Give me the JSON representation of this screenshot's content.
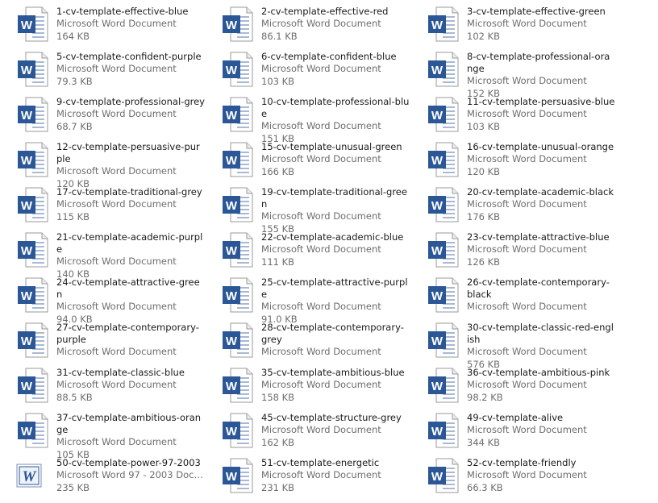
{
  "colors": {
    "word_blue": "#2b5797",
    "name_text": "#1a1a1a",
    "meta_text": "#6d6d6d"
  },
  "icons": {
    "doc": "word-document-icon",
    "doc97": "word-97-2003-document-icon"
  },
  "files": [
    {
      "name": "1-cv-template-effective-blue",
      "type": "Microsoft Word Document",
      "size": "164 KB"
    },
    {
      "name": "2-cv-template-effective-red",
      "type": "Microsoft Word Document",
      "size": "86.1 KB"
    },
    {
      "name": "3-cv-template-effective-green",
      "type": "Microsoft Word Document",
      "size": "102 KB"
    },
    {
      "name": "5-cv-template-confident-purple",
      "type": "Microsoft Word Document",
      "size": "79.3 KB"
    },
    {
      "name": "6-cv-template-confident-blue",
      "type": "Microsoft Word Document",
      "size": "103 KB"
    },
    {
      "name": "8-cv-template-professional-orange",
      "type": "Microsoft Word Document",
      "size": "152 KB"
    },
    {
      "name": "9-cv-template-professional-grey",
      "type": "Microsoft Word Document",
      "size": "68.7 KB"
    },
    {
      "name": "10-cv-template-professional-blue",
      "type": "Microsoft Word Document",
      "size": "151 KB"
    },
    {
      "name": "11-cv-template-persuasive-blue",
      "type": "Microsoft Word Document",
      "size": "103 KB"
    },
    {
      "name": "12-cv-template-persuasive-purple",
      "type": "Microsoft Word Document",
      "size": "120 KB"
    },
    {
      "name": "15-cv-template-unusual-green",
      "type": "Microsoft Word Document",
      "size": "166 KB"
    },
    {
      "name": "16-cv-template-unusual-orange",
      "type": "Microsoft Word Document",
      "size": "120 KB"
    },
    {
      "name": "17-cv-template-traditional-grey",
      "type": "Microsoft Word Document",
      "size": "115 KB"
    },
    {
      "name": "19-cv-template-traditional-green",
      "type": "Microsoft Word Document",
      "size": "155 KB"
    },
    {
      "name": "20-cv-template-academic-black",
      "type": "Microsoft Word Document",
      "size": "176 KB"
    },
    {
      "name": "21-cv-template-academic-purple",
      "type": "Microsoft Word Document",
      "size": "140 KB"
    },
    {
      "name": "22-cv-template-academic-blue",
      "type": "Microsoft Word Document",
      "size": "111 KB"
    },
    {
      "name": "23-cv-template-attractive-blue",
      "type": "Microsoft Word Document",
      "size": "126 KB"
    },
    {
      "name": "24-cv-template-attractive-green",
      "type": "Microsoft Word Document",
      "size": "94.0 KB"
    },
    {
      "name": "25-cv-template-attractive-purple",
      "type": "Microsoft Word Document",
      "size": "91.0 KB"
    },
    {
      "name": "26-cv-template-contemporary-black",
      "type": "Microsoft Word Document",
      "size": ""
    },
    {
      "name": "27-cv-template-contemporary-purple",
      "type": "Microsoft Word Document",
      "size": ""
    },
    {
      "name": "28-cv-template-contemporary-grey",
      "type": "Microsoft Word Document",
      "size": ""
    },
    {
      "name": "30-cv-template-classic-red-english",
      "type": "Microsoft Word Document",
      "size": "576 KB"
    },
    {
      "name": "31-cv-template-classic-blue",
      "type": "Microsoft Word Document",
      "size": "88.5 KB"
    },
    {
      "name": "35-cv-template-ambitious-blue",
      "type": "Microsoft Word Document",
      "size": "158 KB"
    },
    {
      "name": "36-cv-template-ambitious-pink",
      "type": "Microsoft Word Document",
      "size": "98.2 KB"
    },
    {
      "name": "37-cv-template-ambitious-orange",
      "type": "Microsoft Word Document",
      "size": "105 KB"
    },
    {
      "name": "45-cv-template-structure-grey",
      "type": "Microsoft Word Document",
      "size": "162 KB"
    },
    {
      "name": "49-cv-template-alive",
      "type": "Microsoft Word Document",
      "size": "344 KB"
    },
    {
      "name": "50-cv-template-power-97-2003",
      "type": "Microsoft Word 97 - 2003 Docum...",
      "size": "235 KB"
    },
    {
      "name": "51-cv-template-energetic",
      "type": "Microsoft Word Document",
      "size": "231 KB"
    },
    {
      "name": "52-cv-template-friendly",
      "type": "Microsoft Word Document",
      "size": "66.3 KB"
    }
  ]
}
